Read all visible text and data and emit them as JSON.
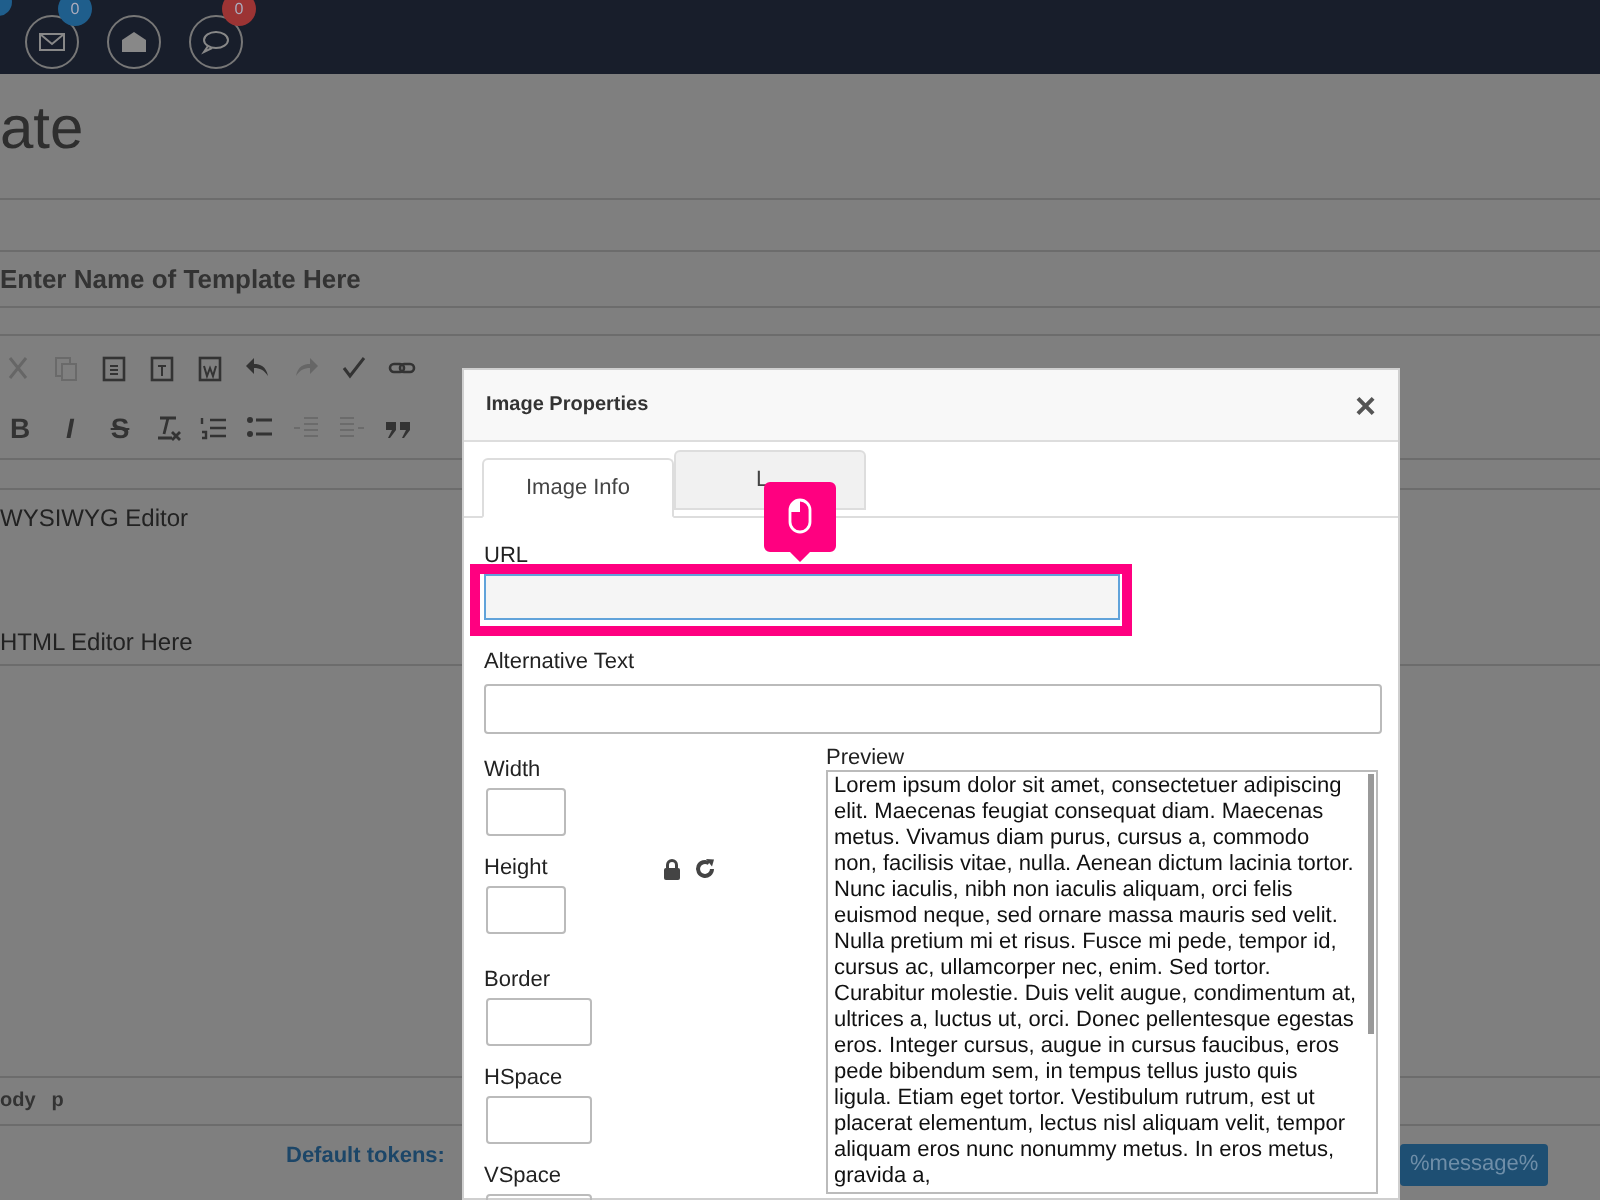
{
  "top_bar": {
    "badges": [
      {
        "count": "0",
        "color": "#1f5e8c"
      },
      {
        "count": "0",
        "color": "#9c3434"
      }
    ]
  },
  "page": {
    "heading": "ate",
    "name_field": {
      "placeholder": "Enter Name of Template Here"
    },
    "format_buttons": [
      "B",
      "I",
      "S"
    ],
    "editor_lines": [
      "WYSIWYG Editor",
      "HTML Editor Here"
    ],
    "path": [
      "ody",
      "p"
    ],
    "tokens_label": "Default tokens:",
    "token": "%message%"
  },
  "dialog": {
    "title": "Image Properties",
    "close": "×",
    "tabs": [
      {
        "label": "Image Info",
        "selected": true
      },
      {
        "label": "L",
        "selected": false
      }
    ],
    "url_label": "URL",
    "alt_label": "Alternative Text",
    "size_fields": [
      {
        "label": "Width"
      },
      {
        "label": "Height"
      },
      {
        "label": "Border"
      },
      {
        "label": "HSpace"
      },
      {
        "label": "VSpace"
      }
    ],
    "preview_label": "Preview",
    "preview_text": "Lorem ipsum dolor sit amet, consectetuer adipiscing elit. Maecenas feugiat consequat diam. Maecenas metus. Vivamus diam purus, cursus a, commodo non, facilisis vitae, nulla. Aenean dictum lacinia tortor. Nunc iaculis, nibh non iaculis aliquam, orci felis euismod neque, sed ornare massa mauris sed velit. Nulla pretium mi et risus. Fusce mi pede, tempor id, cursus ac, ullamcorper nec, enim. Sed tortor. Curabitur molestie. Duis velit augue, condimentum at, ultrices a, luctus ut, orci. Donec pellentesque egestas eros. Integer cursus, augue in cursus faucibus, eros pede bibendum sem, in tempus tellus justo quis ligula. Etiam eget tortor. Vestibulum rutrum, est ut placerat elementum, lectus nisl aliquam velit, tempor aliquam eros nunc nonummy metus. In eros metus, gravida a,"
  }
}
